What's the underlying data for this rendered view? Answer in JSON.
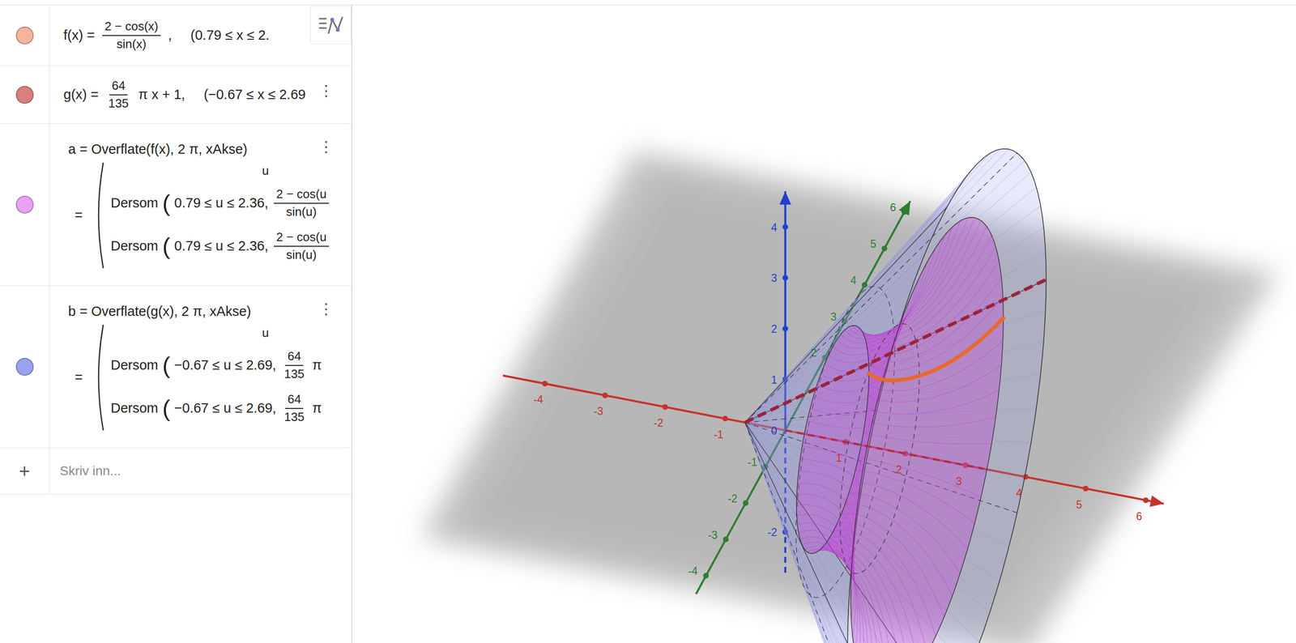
{
  "algebra": {
    "rows": [
      {
        "name": "f",
        "kind": "function",
        "color": "#f7b39b",
        "segments": [
          {
            "kind": "text",
            "text": "f(x) ="
          },
          {
            "kind": "fraction",
            "num": "2 − cos(x)",
            "den": "sin(x)"
          },
          {
            "kind": "text",
            "text": ","
          },
          {
            "kind": "domain",
            "text": "(0.79 ≤ x ≤ 2."
          }
        ]
      },
      {
        "name": "g",
        "kind": "function",
        "color": "#d9807e",
        "menu": "⋮",
        "segments": [
          {
            "kind": "text",
            "text": "g(x) ="
          },
          {
            "kind": "fraction",
            "num": "64",
            "den": "135"
          },
          {
            "kind": "text",
            "text": "π x + 1,"
          },
          {
            "kind": "domain",
            "text": "(−0.67 ≤ x ≤ 2.69"
          }
        ]
      },
      {
        "name": "a",
        "kind": "surface",
        "color": "#e8a2f2",
        "menu": "⋮",
        "definition": "a = Overflate(f(x), 2 π, xAkse)",
        "output": {
          "equals": "=",
          "header": "u",
          "lines": [
            [
              {
                "kind": "text",
                "text": "Dersom"
              },
              {
                "kind": "paren",
                "text": "("
              },
              {
                "kind": "text",
                "text": "0.79 ≤ u ≤ 2.36,"
              },
              {
                "kind": "fraction",
                "num": "2 − cos(u",
                "den": "sin(u)"
              }
            ],
            [
              {
                "kind": "text",
                "text": "Dersom"
              },
              {
                "kind": "paren",
                "text": "("
              },
              {
                "kind": "text",
                "text": "0.79 ≤ u ≤ 2.36,"
              },
              {
                "kind": "fraction",
                "num": "2 − cos(u",
                "den": "sin(u)"
              }
            ]
          ]
        }
      },
      {
        "name": "b",
        "kind": "surface",
        "color": "#9aa2f0",
        "menu": "⋮",
        "definition": "b = Overflate(g(x), 2 π, xAkse)",
        "output": {
          "equals": "=",
          "header": "u",
          "lines": [
            [
              {
                "kind": "text",
                "text": "Dersom"
              },
              {
                "kind": "paren",
                "text": "("
              },
              {
                "kind": "text",
                "text": "−0.67 ≤ u ≤ 2.69,"
              },
              {
                "kind": "fraction",
                "num": "64",
                "den": "135"
              },
              {
                "kind": "text",
                "text": "π"
              }
            ],
            [
              {
                "kind": "text",
                "text": "Dersom"
              },
              {
                "kind": "paren",
                "text": "("
              },
              {
                "kind": "text",
                "text": "−0.67 ≤ u ≤ 2.69,"
              },
              {
                "kind": "fraction",
                "num": "64",
                "den": "135"
              },
              {
                "kind": "text",
                "text": "π"
              }
            ]
          ]
        }
      }
    ],
    "input": {
      "icon": "+",
      "placeholder": "Skriv inn..."
    }
  },
  "graphics": {
    "axes": [
      {
        "name": "x",
        "color": "#c8322a",
        "ticks": [
          "-4",
          "-3",
          "-2",
          "-1",
          "1",
          "2",
          "3",
          "4",
          "5",
          "6"
        ]
      },
      {
        "name": "y",
        "color": "#2f7d32",
        "ticks": [
          "-4",
          "-3",
          "-2",
          "-1",
          "2",
          "3",
          "4",
          "5",
          "6"
        ]
      },
      {
        "name": "z",
        "color": "#1f3fd0",
        "ticks": [
          "-2",
          "0",
          "1",
          "2",
          "3",
          "4"
        ]
      }
    ]
  }
}
